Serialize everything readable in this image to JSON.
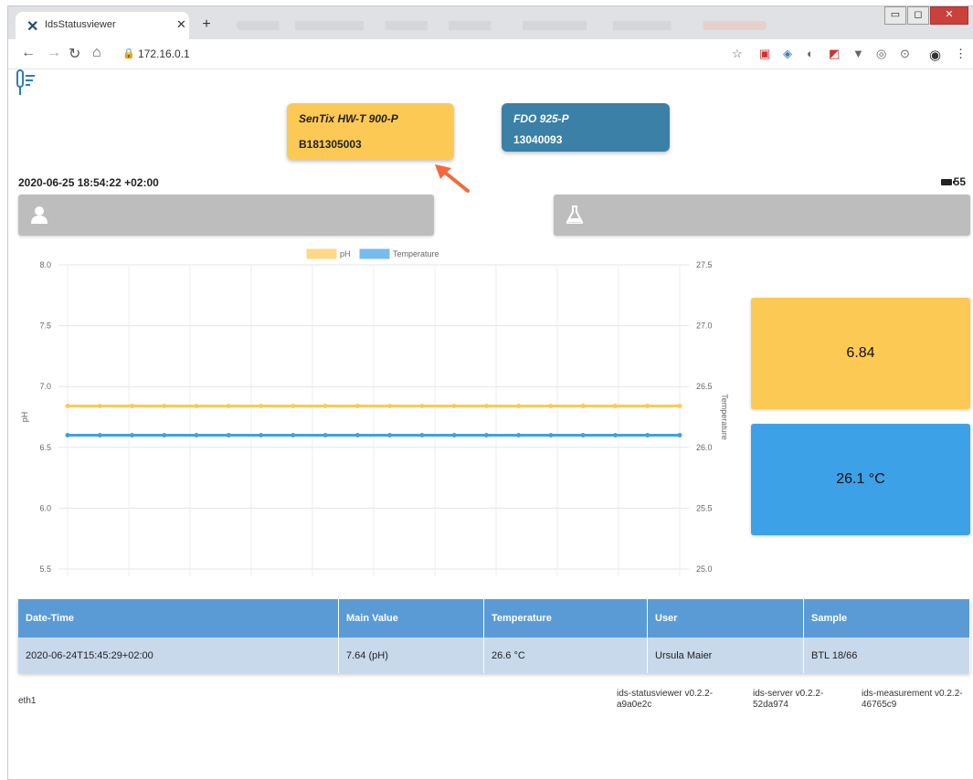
{
  "browser": {
    "tab_title": "IdsStatusviewer",
    "url": "172.16.0.1"
  },
  "sensors": [
    {
      "name": "SenTix HW-T 900-P",
      "id": "B181305003"
    },
    {
      "name": "FDO 925-P",
      "id": "13040093"
    }
  ],
  "status": {
    "datetime": "2020-06-25 18:54:22 +02:00",
    "battery": "55"
  },
  "chart_data": {
    "type": "line",
    "legend": [
      "pH",
      "Temperature"
    ],
    "legend_position": "top",
    "ylabel": "pH",
    "ylabel_right": "Temperature",
    "y_ticks": [
      "8.0",
      "7.5",
      "7.0",
      "6.5",
      "6.0",
      "5.5"
    ],
    "y2_ticks": [
      "27.5",
      "27.0",
      "26.5",
      "26.0",
      "25.5",
      "25.0"
    ],
    "ylim": [
      5.5,
      8.0
    ],
    "y2lim": [
      25.0,
      27.5
    ],
    "grid": true,
    "series": [
      {
        "name": "pH",
        "axis": "left",
        "color": "#fdc955",
        "values": [
          6.84,
          6.84,
          6.84,
          6.84,
          6.84,
          6.84,
          6.84,
          6.84,
          6.84,
          6.84,
          6.84,
          6.84,
          6.84,
          6.84,
          6.84,
          6.84,
          6.84,
          6.84,
          6.84,
          6.84
        ]
      },
      {
        "name": "Temperature",
        "axis": "right",
        "color": "#3da1e7",
        "values": [
          26.1,
          26.1,
          26.1,
          26.1,
          26.1,
          26.1,
          26.1,
          26.1,
          26.1,
          26.1,
          26.1,
          26.1,
          26.1,
          26.1,
          26.1,
          26.1,
          26.1,
          26.1,
          26.1,
          26.1
        ]
      }
    ]
  },
  "current": {
    "ph": "6.84",
    "temperature": "26.1 °C"
  },
  "table": {
    "headers": [
      "Date-Time",
      "Main Value",
      "Temperature",
      "User",
      "Sample"
    ],
    "rows": [
      [
        "2020-06-24T15:45:29+02:00",
        "7.64 (pH)",
        "26.6 °C",
        "Ursula Maier",
        "BTL 18/66"
      ]
    ]
  },
  "footer": {
    "interface": "eth1",
    "statusviewer_version": "ids-statusviewer v0.2.2-a9a0e2c",
    "server_version": "ids-server v0.2.2-52da974",
    "measurement_version": "ids-measurement v0.2.2-46765c9"
  },
  "colors": {
    "ph": "#fdc955",
    "temperature": "#3da1e7",
    "fdo_card": "#3a80a7",
    "table_header": "#5b9bd5",
    "table_row": "#c8d9ec"
  }
}
